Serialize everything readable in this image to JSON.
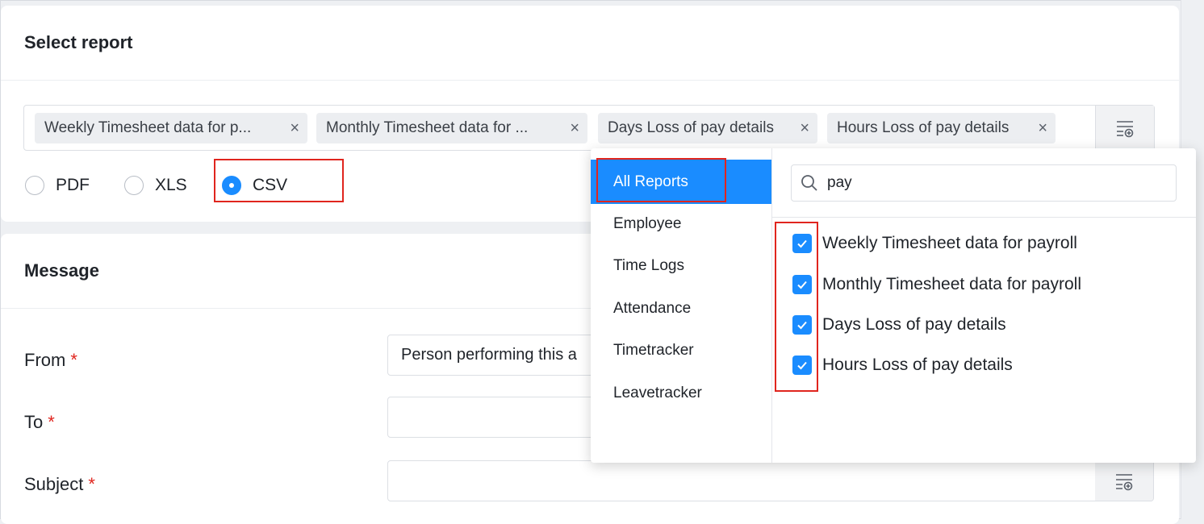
{
  "report": {
    "title": "Select report",
    "tags": [
      {
        "label": "Weekly Timesheet data for p..."
      },
      {
        "label": "Monthly Timesheet data for ..."
      },
      {
        "label": "Days Loss of pay details"
      },
      {
        "label": "Hours Loss of pay details"
      }
    ],
    "tag_remove_glyph": "×",
    "formats": [
      {
        "label": "PDF",
        "checked": false
      },
      {
        "label": "XLS",
        "checked": false
      },
      {
        "label": "CSV",
        "checked": true
      }
    ]
  },
  "message": {
    "title": "Message",
    "required_mark": "*",
    "fields": {
      "from": {
        "label": "From",
        "value": "Person performing this a"
      },
      "to": {
        "label": "To",
        "value": ""
      },
      "subject": {
        "label": "Subject",
        "value": ""
      }
    }
  },
  "dropdown": {
    "categories": [
      "All Reports",
      "Employee",
      "Time Logs",
      "Attendance",
      "Timetracker",
      "Leavetracker"
    ],
    "active_category": "All Reports",
    "search_value": "pay",
    "results": [
      {
        "label": "Weekly Timesheet data for payroll",
        "checked": true
      },
      {
        "label": "Monthly Timesheet data for payroll",
        "checked": true
      },
      {
        "label": "Days Loss of pay details",
        "checked": true
      },
      {
        "label": "Hours Loss of pay details",
        "checked": true
      }
    ]
  },
  "colors": {
    "accent": "#1a8cff",
    "highlight_box": "#e0251e",
    "required": "#e0251e"
  },
  "icons": [
    "report-picker-icon",
    "close-icon",
    "search-icon",
    "checkmark-icon"
  ]
}
